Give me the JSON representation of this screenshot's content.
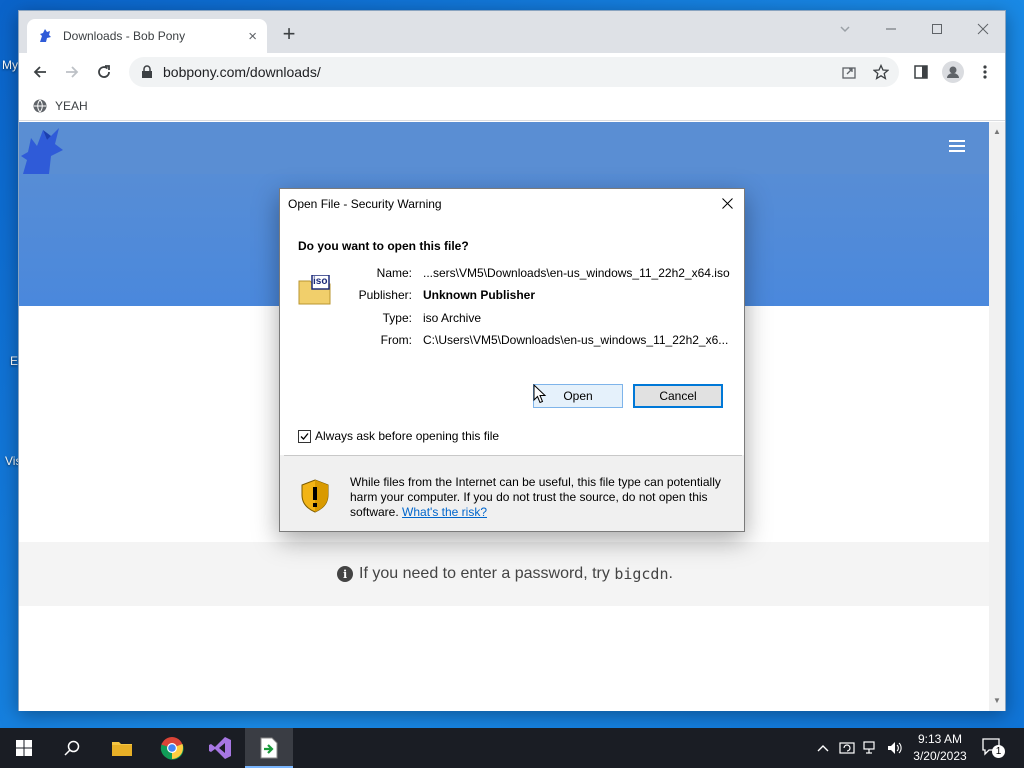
{
  "desktop": {
    "labels": [
      "My",
      "E",
      "Vis"
    ]
  },
  "browser": {
    "tab_title": "Downloads - Bob Pony",
    "tab_close": "×",
    "new_tab": "+",
    "url": "bobpony.com/downloads/",
    "bookmark": "YEAH"
  },
  "page": {
    "info_prefix": "If you need to enter a password, try",
    "info_code": "bigcdn",
    "info_suffix": ".",
    "info_icon": "i"
  },
  "dialog": {
    "title": "Open File - Security Warning",
    "question": "Do you want to open this file?",
    "icon_label": "iso",
    "fields": [
      {
        "label": "Name:",
        "value": "...sers\\VM5\\Downloads\\en-us_windows_11_22h2_x64.iso"
      },
      {
        "label": "Publisher:",
        "value": "Unknown Publisher"
      },
      {
        "label": "Type:",
        "value": "iso Archive"
      },
      {
        "label": "From:",
        "value": "C:\\Users\\VM5\\Downloads\\en-us_windows_11_22h2_x6..."
      }
    ],
    "open_label": "Open",
    "cancel_label": "Cancel",
    "checkbox_label": "Always ask before opening this file",
    "checkbox_checked": true,
    "warning_text": "While files from the Internet can be useful, this file type can potentially harm your computer. If you do not trust the source, do not open this software.",
    "risk_link": "What's the risk?"
  },
  "taskbar": {
    "time": "9:13 AM",
    "date": "3/20/2023",
    "notification_count": "1"
  },
  "colors": {
    "hero": "#4a88dc",
    "link": "#0066cc",
    "accent": "#0078d7"
  }
}
